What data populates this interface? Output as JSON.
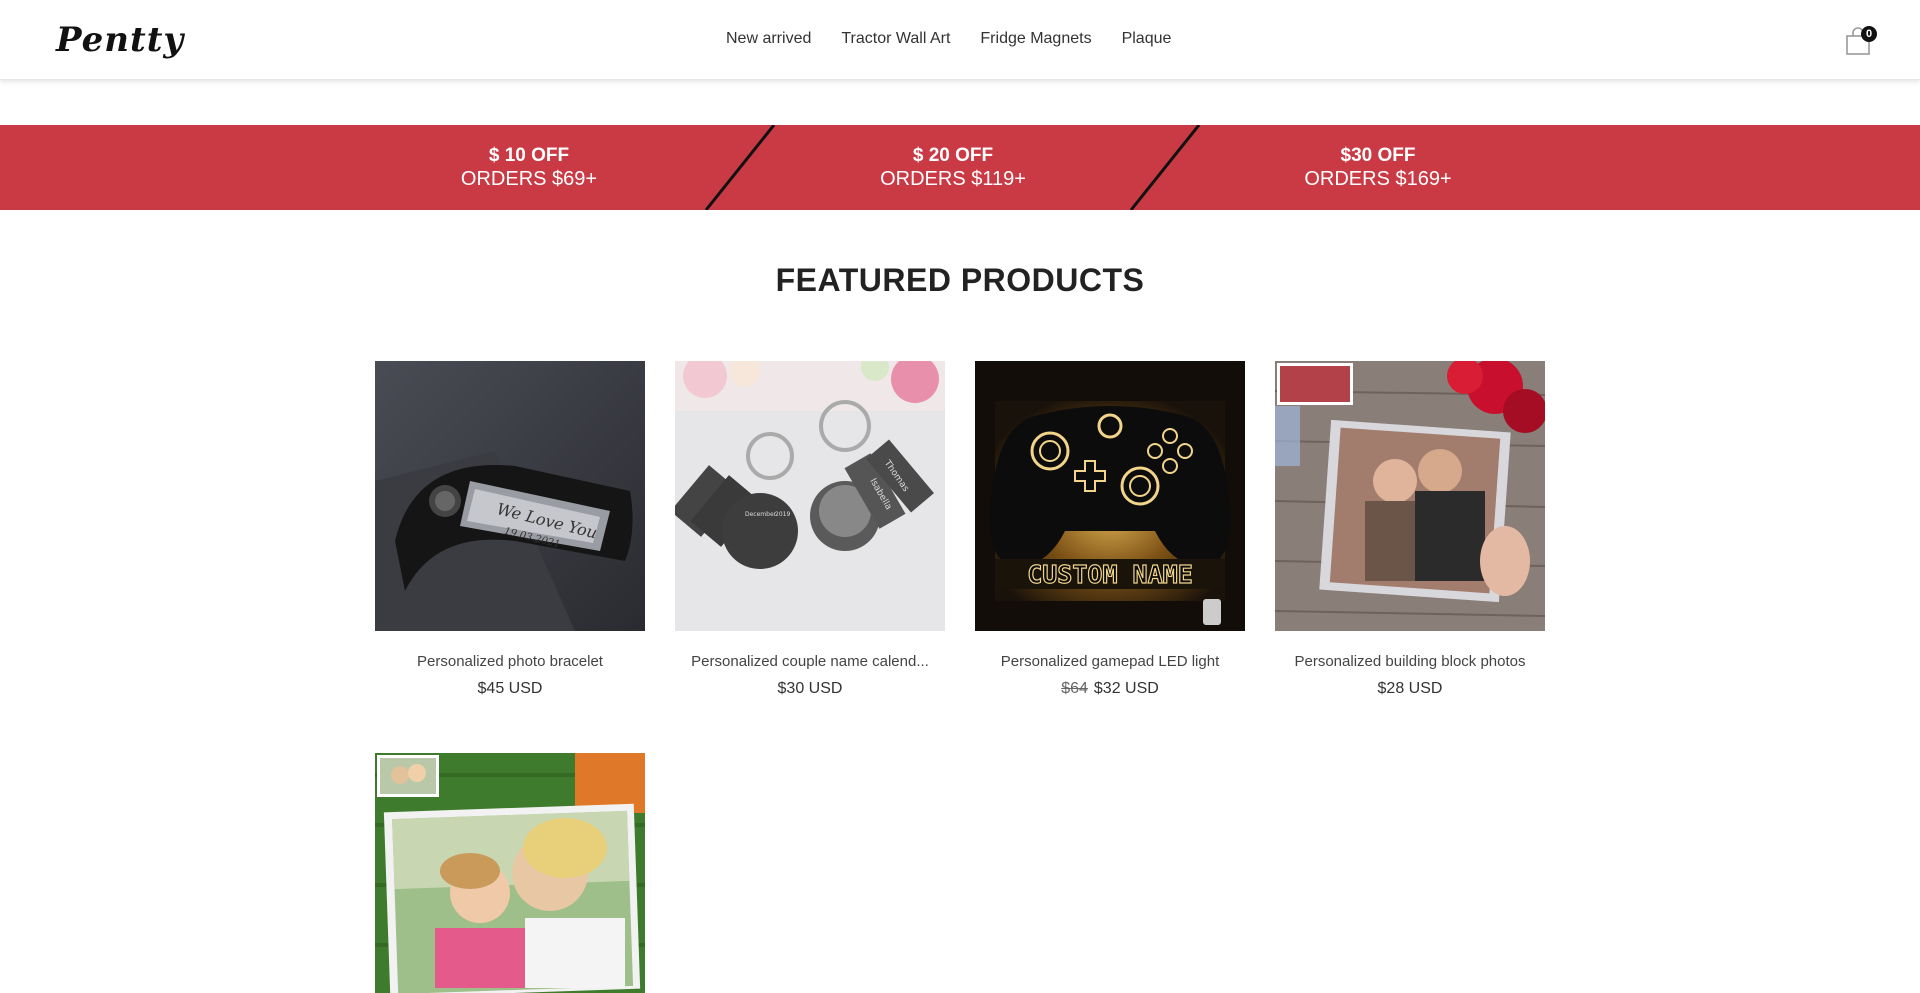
{
  "header": {
    "logo_text": "Pentty",
    "nav": [
      "New arrived",
      "Tractor Wall Art",
      "Fridge Magnets",
      "Plaque"
    ],
    "cart_count": "0"
  },
  "banner": {
    "offers": [
      {
        "amount": "$ 10 OFF",
        "orders": "ORDERS $69+"
      },
      {
        "amount": "$ 20 OFF",
        "orders": "ORDERS $119+"
      },
      {
        "amount": "$30 OFF",
        "orders": "ORDERS $169+"
      }
    ],
    "color": "#c93a45"
  },
  "section": {
    "title": "FEATURED PRODUCTS"
  },
  "products": [
    {
      "title": "Personalized photo bracelet",
      "price": "$45 USD"
    },
    {
      "title": "Personalized couple name calend...",
      "price": "$30 USD"
    },
    {
      "title": "Personalized gamepad LED light",
      "price_old": "$64",
      "price": "$32 USD"
    },
    {
      "title": "Personalized building block photos",
      "price": "$28 USD"
    },
    {
      "title": "",
      "price": ""
    }
  ],
  "product_image_texts": {
    "bracelet_engraving": "We Love You",
    "bracelet_date": "19.03.2021",
    "keychain_tag_1": "Thomas",
    "keychain_tag_2": "Isabella",
    "keychain_month": "December",
    "keychain_year": "2019",
    "gamepad_label": "CUSTOM NAME"
  }
}
